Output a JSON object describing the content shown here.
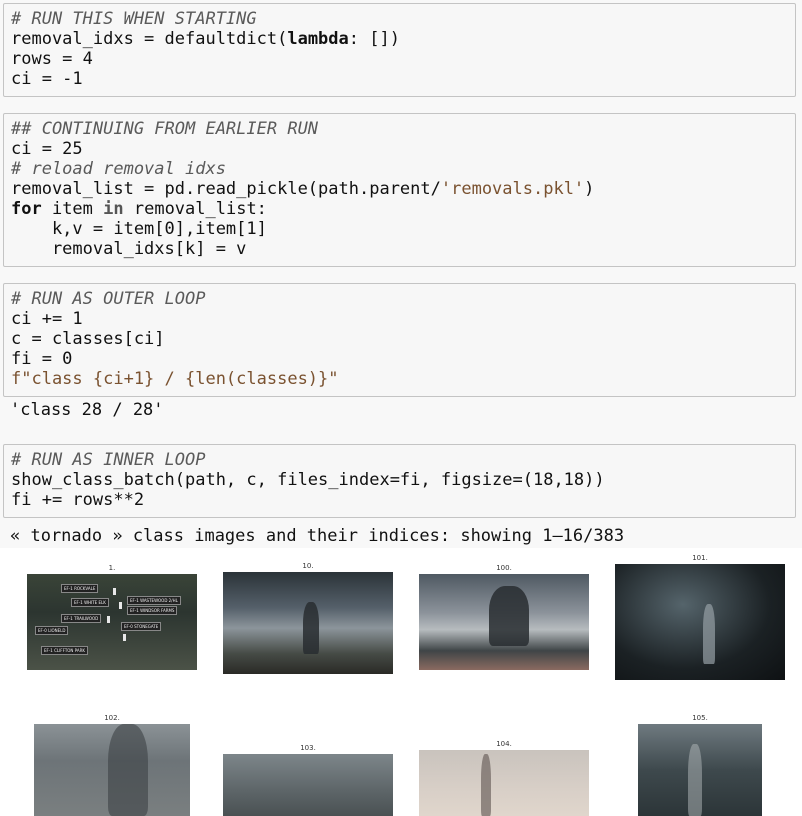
{
  "cells": [
    {
      "id": "cell-start",
      "lines": [
        {
          "comment": "# RUN THIS WHEN STARTING"
        },
        {
          "text": "removal_idxs = defaultdict(",
          "kw": "lambda",
          "rest": ": [])"
        },
        {
          "text": "rows = 4"
        },
        {
          "text": "ci = -1"
        }
      ]
    },
    {
      "id": "cell-continue",
      "lines": [
        {
          "comment": "## CONTINUING FROM EARLIER RUN"
        },
        {
          "text": "ci = 25"
        },
        {
          "comment": "# reload removal idxs"
        },
        {
          "text": "removal_list = pd.read_pickle(path.parent/",
          "str": "'removals.pkl'",
          "rest": ")"
        },
        {
          "kw": "for",
          "text": " item ",
          "op": "in",
          "rest": " removal_list:"
        },
        {
          "text": "    k,v = item[0],item[1]"
        },
        {
          "text": "    removal_idxs[k] = v"
        }
      ]
    },
    {
      "id": "cell-outer",
      "lines": [
        {
          "comment": "# RUN AS OUTER LOOP"
        },
        {
          "text": "ci += 1"
        },
        {
          "text": "c = classes[ci]"
        },
        {
          "text": "fi = 0"
        },
        {
          "text": "f\"class {ci+1} / {len(classes)}\""
        }
      ]
    },
    {
      "id": "cell-inner",
      "lines": [
        {
          "comment": "# RUN AS INNER LOOP"
        },
        {
          "text": "show_class_batch(path, c, files_index=fi, figsize=(18,18))"
        },
        {
          "text": "fi += rows**2"
        }
      ]
    }
  ],
  "outputs": {
    "outer": "'class 28 / 28'",
    "inner": "« tornado » class images and their indices: showing 1–16/383"
  },
  "thumbnails": [
    {
      "label": "1.",
      "kind": "map"
    },
    {
      "label": "10.",
      "kind": "storm1"
    },
    {
      "label": "100.",
      "kind": "storm2"
    },
    {
      "label": "101.",
      "kind": "storm3"
    },
    {
      "label": "102.",
      "kind": "storm4"
    },
    {
      "label": "103.",
      "kind": "storm5"
    },
    {
      "label": "104.",
      "kind": "storm6"
    },
    {
      "label": "105.",
      "kind": "storm7"
    }
  ],
  "map_labels": [
    "EF-1 ROCKVALE",
    "EF-1 WHITE ELK",
    "EF-1 WASTEWOOD 2/HL",
    "EF-1 WINDSOR FARMS",
    "EF-0 STONEGATE",
    "EF-1 TRAILWOOD",
    "EF-0 LIONELD",
    "EF-1 CLIFFTON PARK"
  ]
}
